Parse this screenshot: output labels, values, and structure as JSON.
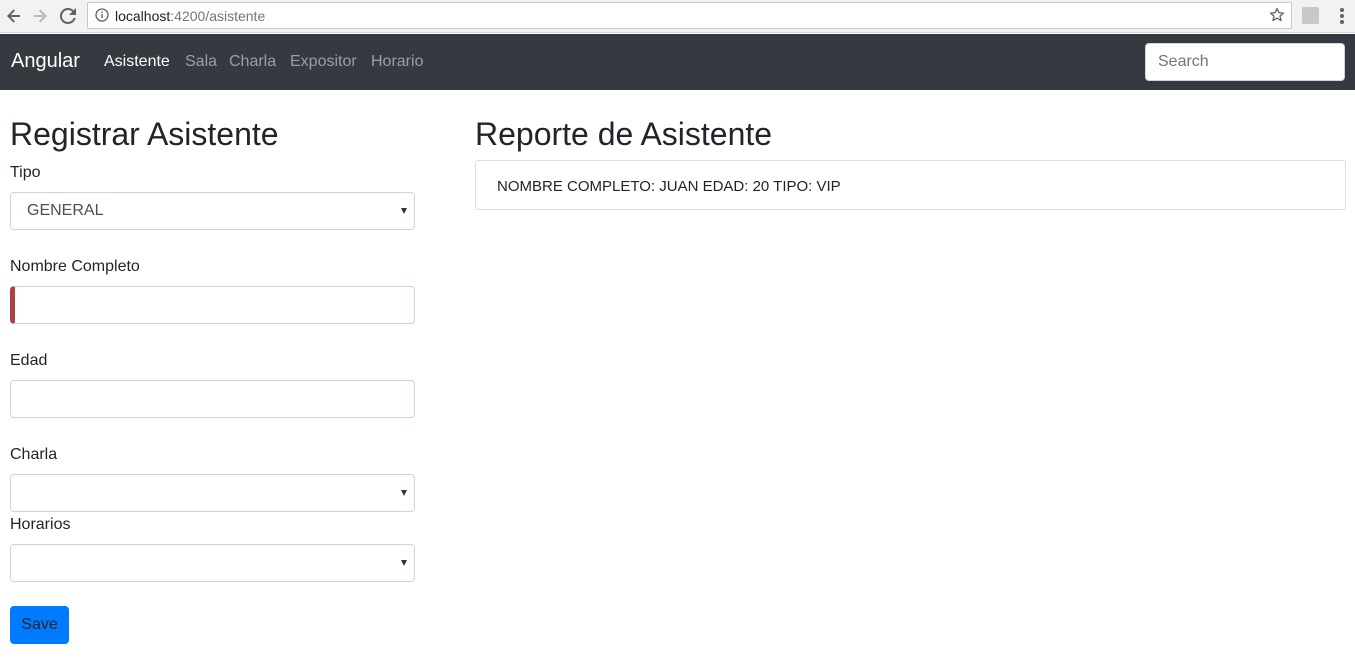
{
  "browser": {
    "url_host": "localhost",
    "url_path": ":4200/asistente"
  },
  "navbar": {
    "brand": "Angular",
    "links": [
      {
        "label": "Asistente",
        "active": true
      },
      {
        "label": "Sala",
        "active": false
      },
      {
        "label": "Charla",
        "active": false
      },
      {
        "label": "Expositor",
        "active": false
      },
      {
        "label": "Horario",
        "active": false
      }
    ],
    "search_placeholder": "Search"
  },
  "form": {
    "title": "Registrar Asistente",
    "tipo_label": "Tipo",
    "tipo_value": "GENERAL",
    "nombre_label": "Nombre Completo",
    "nombre_value": "",
    "edad_label": "Edad",
    "edad_value": "",
    "charla_label": "Charla",
    "charla_value": "",
    "horarios_label": "Horarios",
    "horarios_value": "",
    "save_label": "Save"
  },
  "report": {
    "title": "Reporte de Asistente",
    "entry": "NOMBRE COMPLETO: JUAN EDAD: 20 TIPO: VIP"
  },
  "colors": {
    "navbar_bg": "#343a40",
    "primary": "#007bff",
    "invalid": "#a94442"
  }
}
